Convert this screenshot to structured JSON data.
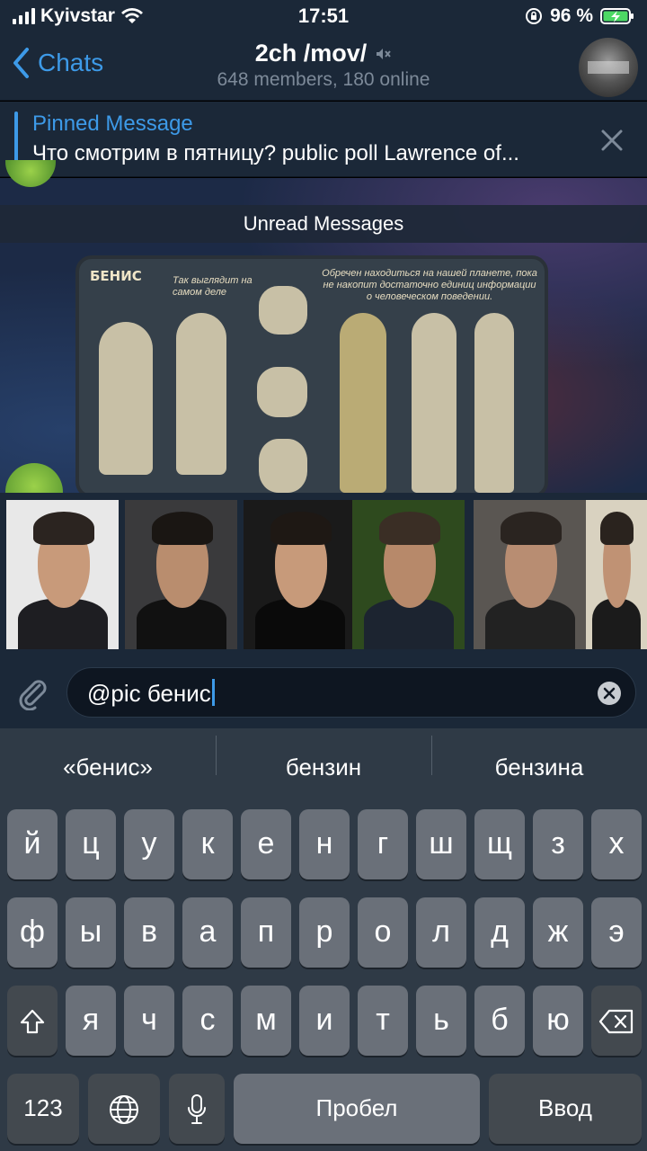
{
  "status_bar": {
    "carrier": "Kyivstar",
    "time": "17:51",
    "battery": "96 %"
  },
  "header": {
    "back_label": "Chats",
    "title": "2ch /mov/",
    "subtitle": "648 members, 180 online"
  },
  "pinned": {
    "title": "Pinned Message",
    "text": "Что смотрим в пятницу? public poll Lawrence of..."
  },
  "chat": {
    "unread_label": "Unread Messages",
    "image_caption": "БЕНИС",
    "image_note_1": "Так выглядит на самом деле",
    "image_note_2": "Обречен находиться на нашей планете, пока не накопит достаточно единиц информации о человеческом поведении."
  },
  "input": {
    "value": "@pic бенис"
  },
  "keyboard": {
    "suggestions": [
      "«бенис»",
      "бензин",
      "бензина"
    ],
    "row1": [
      "й",
      "ц",
      "у",
      "к",
      "е",
      "н",
      "г",
      "ш",
      "щ",
      "з",
      "х"
    ],
    "row2": [
      "ф",
      "ы",
      "в",
      "а",
      "п",
      "р",
      "о",
      "л",
      "д",
      "ж",
      "э"
    ],
    "row3": [
      "я",
      "ч",
      "с",
      "м",
      "и",
      "т",
      "ь",
      "б",
      "ю"
    ],
    "numbers_label": "123",
    "space_label": "Пробел",
    "return_label": "Ввод"
  },
  "colors": {
    "accent": "#3d9ae8",
    "panel": "#1b2838",
    "key": "#6a7079",
    "key_dark": "#43494f"
  }
}
